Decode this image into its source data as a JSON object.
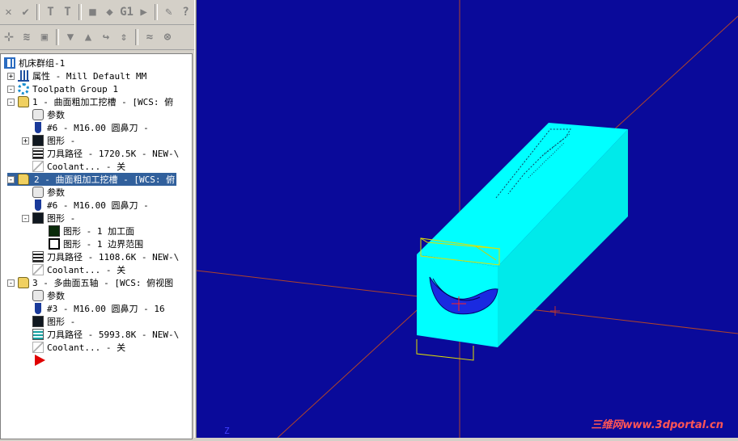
{
  "toolbar1": {
    "buttons": [
      "x-icon",
      "check-x-icon",
      "toolpath-filter-icon",
      "toolpath-clear-icon",
      "stop-icon",
      "shape-icon",
      "g1-label",
      "arrow-right-icon",
      "edit-icon",
      "help-icon"
    ],
    "g1_label": "G1",
    "help_label": "?"
  },
  "toolbar2": {
    "buttons": [
      "move-icon",
      "wave-icon",
      "lock-icon",
      "triangle-down-icon",
      "triangle-up-icon",
      "loop-icon",
      "updown-icon",
      "wave2-icon",
      "link-icon"
    ]
  },
  "tree": {
    "rows": [
      {
        "label": "机床群组-1",
        "indent": 0,
        "expander": "",
        "icon": "machine-group-icon",
        "icls": "ic-machine",
        "selected": false
      },
      {
        "label": "属性 - Mill Default MM",
        "indent": 1,
        "expander": "+",
        "icon": "properties-icon",
        "icls": "ic-bars",
        "selected": false
      },
      {
        "label": "Toolpath Group 1",
        "indent": 1,
        "expander": "-",
        "icon": "toolpath-group-icon",
        "icls": "ic-group",
        "selected": false
      },
      {
        "label": "1 - 曲面粗加工挖槽 - [WCS: 俯",
        "indent": 2,
        "expander": "-",
        "icon": "folder-icon",
        "icls": "ic-folder",
        "selected": false
      },
      {
        "label": "参数",
        "indent": 3,
        "expander": "",
        "icon": "parameters-icon",
        "icls": "ic-param",
        "selected": false
      },
      {
        "label": "#6 - M16.00 圆鼻刀 -",
        "indent": 3,
        "expander": "",
        "icon": "tool-icon",
        "icls": "ic-tool",
        "selected": false
      },
      {
        "label": "图形 -",
        "indent": 3,
        "expander": "+",
        "icon": "geometry-icon",
        "icls": "ic-geo",
        "selected": false
      },
      {
        "label": "刀具路径 - 1720.5K - NEW-\\",
        "indent": 3,
        "expander": "",
        "icon": "toolpath-icon",
        "icls": "ic-path",
        "selected": false
      },
      {
        "label": "Coolant... - 关",
        "indent": 3,
        "expander": "",
        "icon": "coolant-icon",
        "icls": "ic-coolant",
        "selected": false
      },
      {
        "label": "2 - 曲面粗加工挖槽 - [WCS: 俯",
        "indent": 2,
        "expander": "-",
        "icon": "folder-icon",
        "icls": "ic-folder",
        "selected": true
      },
      {
        "label": "参数",
        "indent": 3,
        "expander": "",
        "icon": "parameters-icon",
        "icls": "ic-param",
        "selected": false
      },
      {
        "label": "#6 - M16.00 圆鼻刀 -",
        "indent": 3,
        "expander": "",
        "icon": "tool-icon",
        "icls": "ic-tool",
        "selected": false
      },
      {
        "label": "图形 -",
        "indent": 3,
        "expander": "-",
        "icon": "geometry-icon",
        "icls": "ic-geo",
        "selected": false
      },
      {
        "label": "图形 - 1 加工面",
        "indent": 4,
        "expander": "",
        "icon": "surface-icon",
        "icls": "ic-geo-a",
        "selected": false
      },
      {
        "label": "图形 - 1 边界范围",
        "indent": 4,
        "expander": "",
        "icon": "boundary-icon",
        "icls": "ic-geo-b",
        "selected": false
      },
      {
        "label": "刀具路径 - 1108.6K - NEW-\\",
        "indent": 3,
        "expander": "",
        "icon": "toolpath-icon",
        "icls": "ic-path",
        "selected": false
      },
      {
        "label": "Coolant... - 关",
        "indent": 3,
        "expander": "",
        "icon": "coolant-icon",
        "icls": "ic-coolant",
        "selected": false
      },
      {
        "label": "3 - 多曲面五轴 - [WCS: 俯视图",
        "indent": 2,
        "expander": "-",
        "icon": "folder-icon",
        "icls": "ic-folder",
        "selected": false
      },
      {
        "label": "参数",
        "indent": 3,
        "expander": "",
        "icon": "parameters-icon",
        "icls": "ic-param",
        "selected": false
      },
      {
        "label": "#3 - M16.00 圆鼻刀 -     16",
        "indent": 3,
        "expander": "",
        "icon": "tool-icon",
        "icls": "ic-tool",
        "selected": false
      },
      {
        "label": "图形 -",
        "indent": 3,
        "expander": "",
        "icon": "geometry-icon",
        "icls": "ic-geo",
        "selected": false
      },
      {
        "label": "刀具路径 - 5993.8K - NEW-\\",
        "indent": 3,
        "expander": "",
        "icon": "toolpath-icon",
        "icls": "ic-path2",
        "selected": false
      },
      {
        "label": "Coolant... - 关",
        "indent": 3,
        "expander": "",
        "icon": "coolant-icon",
        "icls": "ic-coolant",
        "selected": false
      }
    ]
  },
  "viewport": {
    "background": "#0a0a9a",
    "stock_color": "#00ffff",
    "axis_color": "#b0442a",
    "z_label": "Z",
    "watermark": "三维网www.3dportal.cn"
  }
}
